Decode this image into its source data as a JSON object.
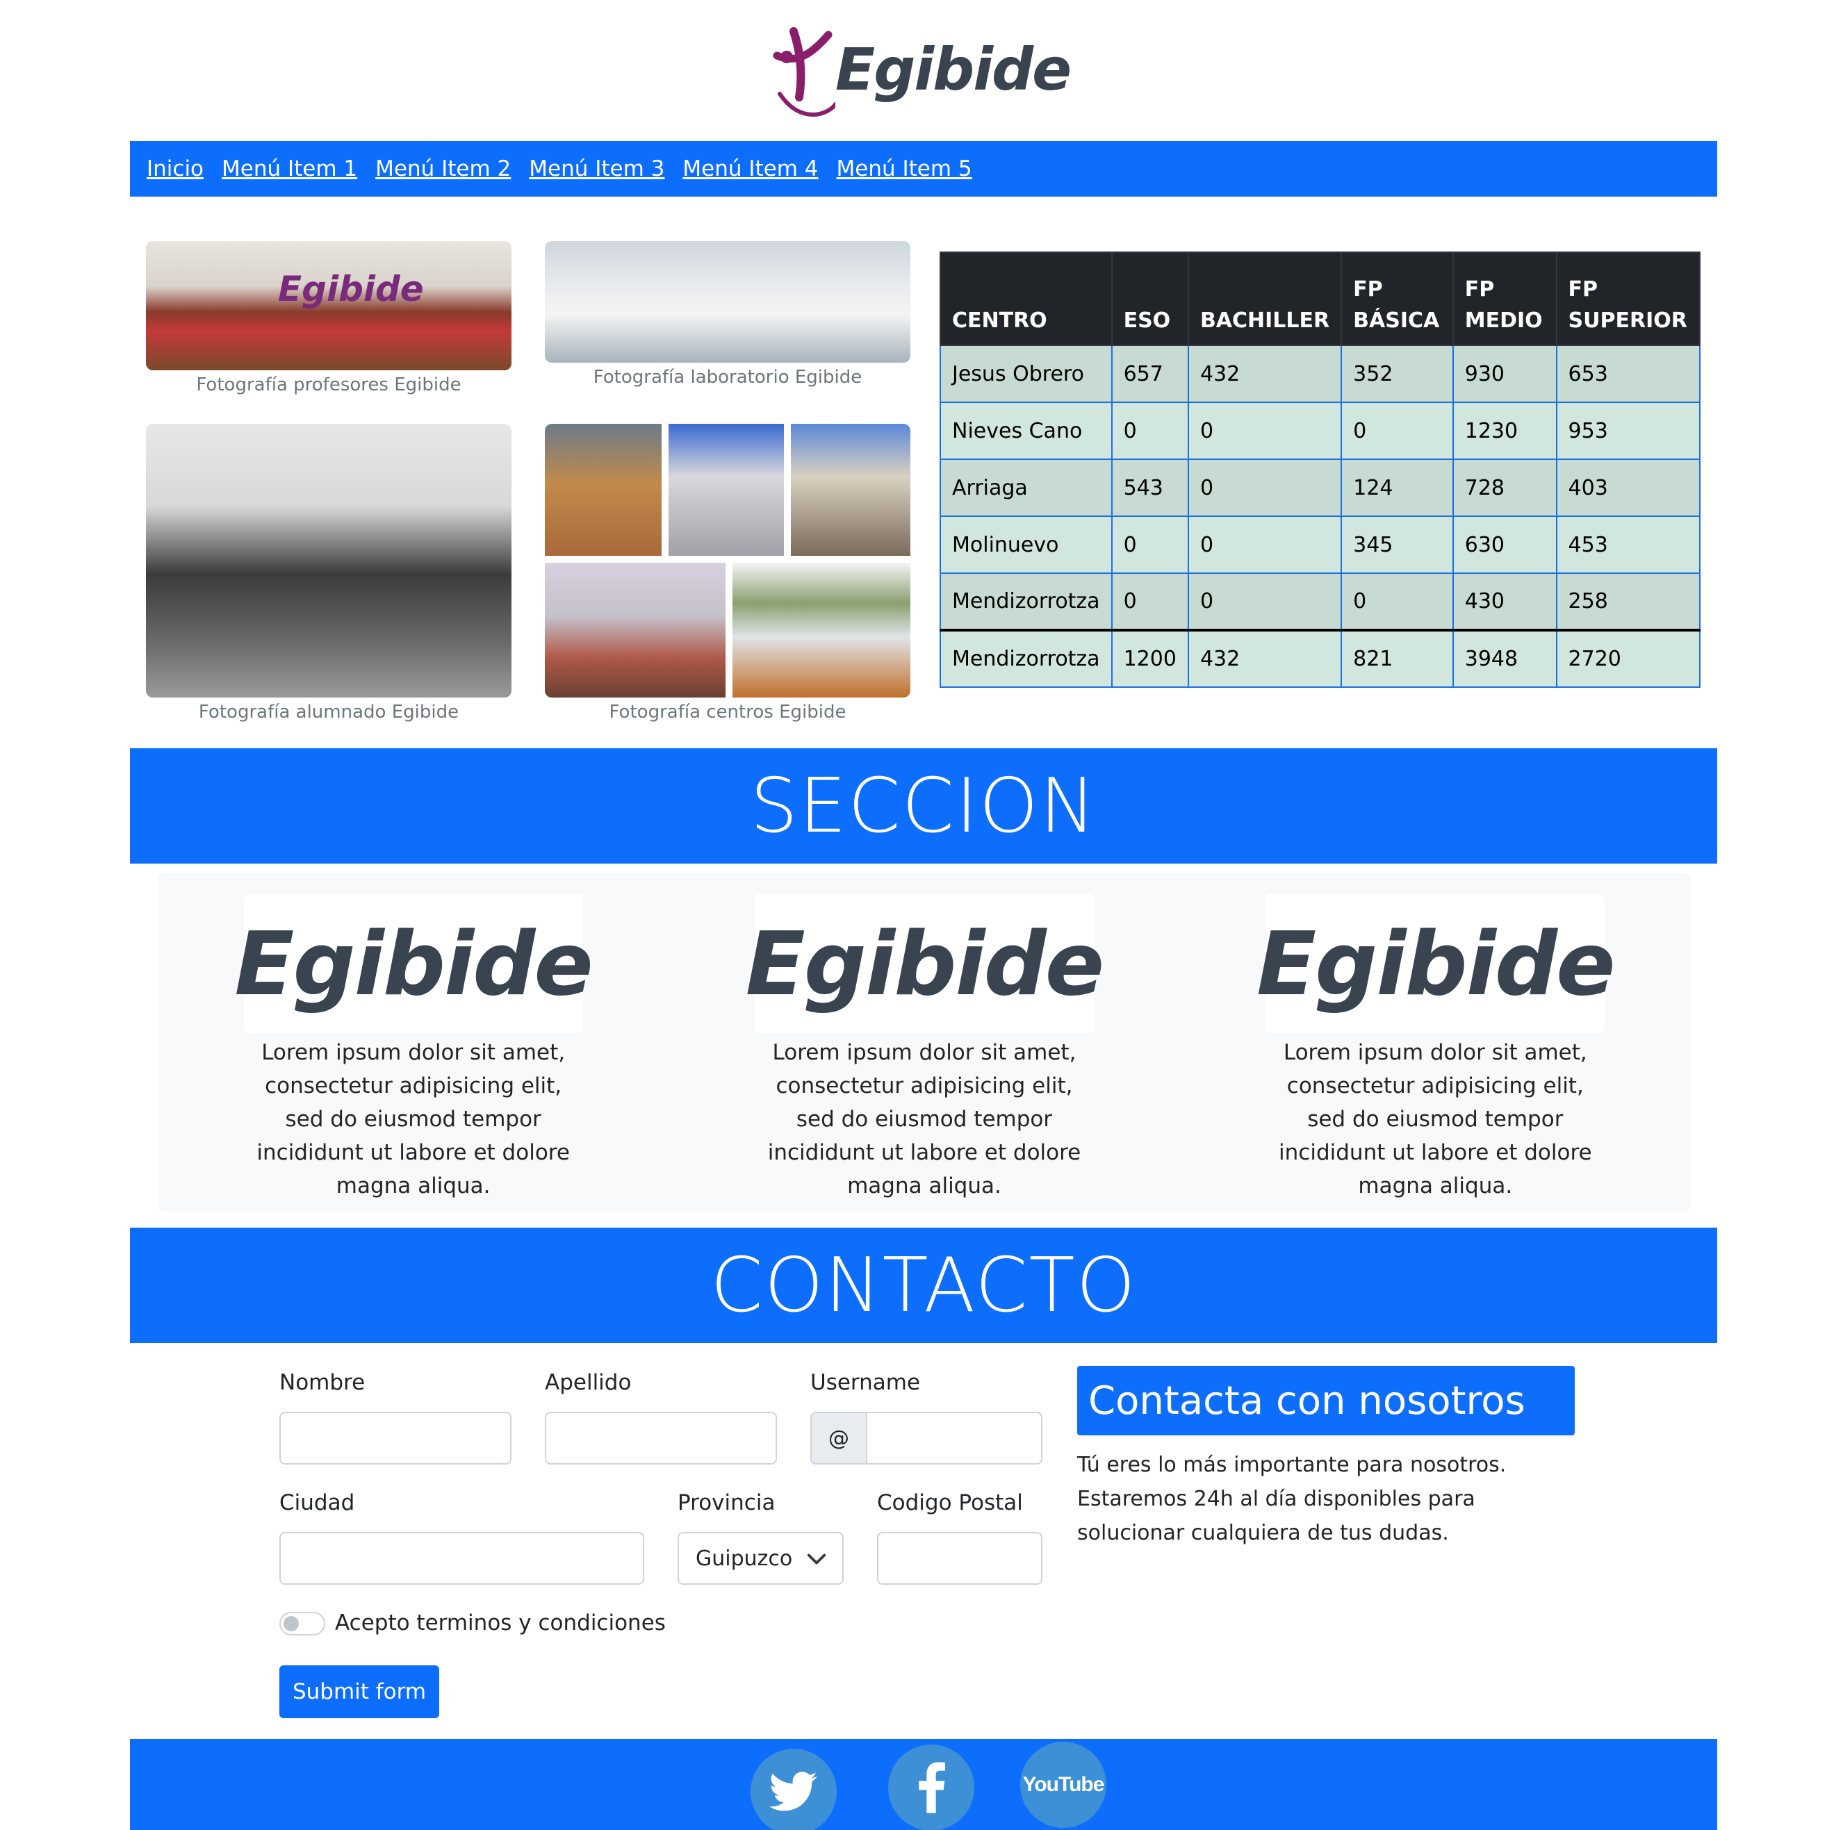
{
  "brand": {
    "logo_text": "Egibide",
    "colors": {
      "primary": "#0d6efd",
      "logo_purple": "#8a1e6b",
      "logo_gray": "#3a4450"
    }
  },
  "nav": {
    "items": [
      "Inicio",
      "Menú Item 1",
      "Menú Item 2",
      "Menú Item 3",
      "Menú Item 4",
      "Menú Item 5"
    ]
  },
  "gallery": [
    {
      "caption": "Fotografía profesores Egibide"
    },
    {
      "caption": "Fotografía laboratorio Egibide"
    },
    {
      "caption": "Fotografía alumnado Egibide"
    },
    {
      "caption": "Fotografía centros Egibide"
    }
  ],
  "table": {
    "headers": [
      "CENTRO",
      "ESO",
      "BACHILLER",
      "FP BÁSICA",
      "FP MEDIO",
      "FP SUPERIOR"
    ],
    "rows": [
      [
        "Jesus Obrero",
        "657",
        "432",
        "352",
        "930",
        "653"
      ],
      [
        "Nieves Cano",
        "0",
        "0",
        "0",
        "1230",
        "953"
      ],
      [
        "Arriaga",
        "543",
        "0",
        "124",
        "728",
        "403"
      ],
      [
        "Molinuevo",
        "0",
        "0",
        "345",
        "630",
        "453"
      ],
      [
        "Mendizorrotza",
        "0",
        "0",
        "0",
        "430",
        "258"
      ]
    ],
    "footer": [
      "Mendizorrotza",
      "1200",
      "432",
      "821",
      "3948",
      "2720"
    ]
  },
  "section": {
    "title": "SECCION"
  },
  "cards": [
    {
      "text": "Lorem ipsum dolor sit amet, consectetur adipisicing elit, sed do eiusmod tempor incididunt ut labore et dolore magna aliqua."
    },
    {
      "text": "Lorem ipsum dolor sit amet, consectetur adipisicing elit, sed do eiusmod tempor incididunt ut labore et dolore magna aliqua."
    },
    {
      "text": "Lorem ipsum dolor sit amet, consectetur adipisicing elit, sed do eiusmod tempor incididunt ut labore et dolore magna aliqua."
    }
  ],
  "contact": {
    "title": "CONTACTO",
    "form": {
      "nombre_label": "Nombre",
      "apellido_label": "Apellido",
      "username_label": "Username",
      "username_prefix": "@",
      "ciudad_label": "Ciudad",
      "provincia_label": "Provincia",
      "provincia_value": "Guipuzcoa",
      "cp_label": "Codigo Postal",
      "terms_label": "Acepto terminos y condiciones",
      "submit_label": "Submit form"
    },
    "box_title": "Contacta con nosotros",
    "box_text": "Tú eres lo más importante para nosotros. Estaremos 24h al día disponibles para solucionar cualquiera de tus dudas."
  },
  "footer": {
    "social": [
      "twitter-icon",
      "facebook-icon",
      "youtube-icon"
    ],
    "youtube_text": "YouTube"
  }
}
